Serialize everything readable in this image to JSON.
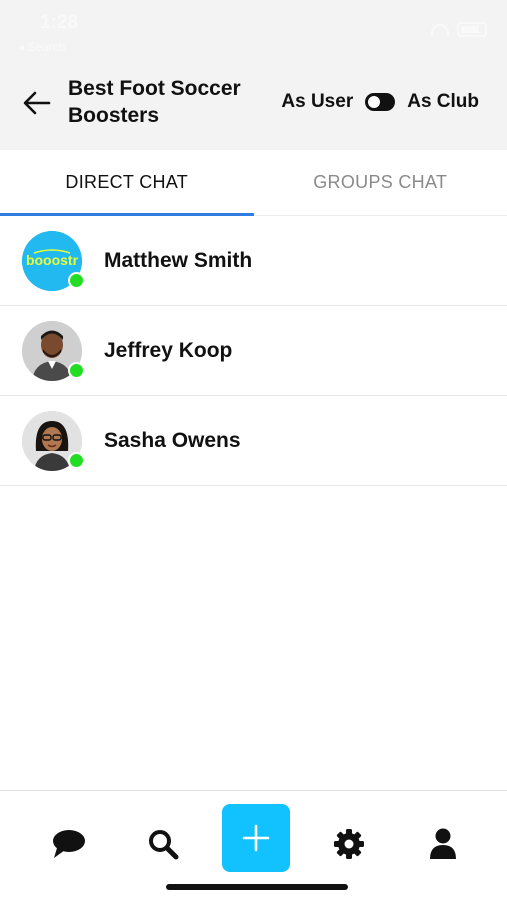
{
  "status_bar": {
    "time": "1:28",
    "back_label": "◂ Search"
  },
  "header": {
    "title": "Best Foot Soccer Boosters",
    "mode_left": "As User",
    "mode_right": "As Club"
  },
  "tabs": [
    {
      "label": "DIRECT CHAT",
      "active": true
    },
    {
      "label": "GROUPS CHAT",
      "active": false
    }
  ],
  "chats": [
    {
      "name": "Matthew Smith",
      "avatar_text": "booostr",
      "online": true
    },
    {
      "name": "Jeffrey Koop",
      "online": true
    },
    {
      "name": "Sasha Owens",
      "online": true
    }
  ],
  "colors": {
    "accent": "#2f7de1",
    "add_button": "#12c2ff",
    "online": "#22dd22",
    "header_bg": "#f3f3f3"
  },
  "nav": [
    "chat-icon",
    "search-icon",
    "plus-icon",
    "gear-icon",
    "user-icon"
  ]
}
